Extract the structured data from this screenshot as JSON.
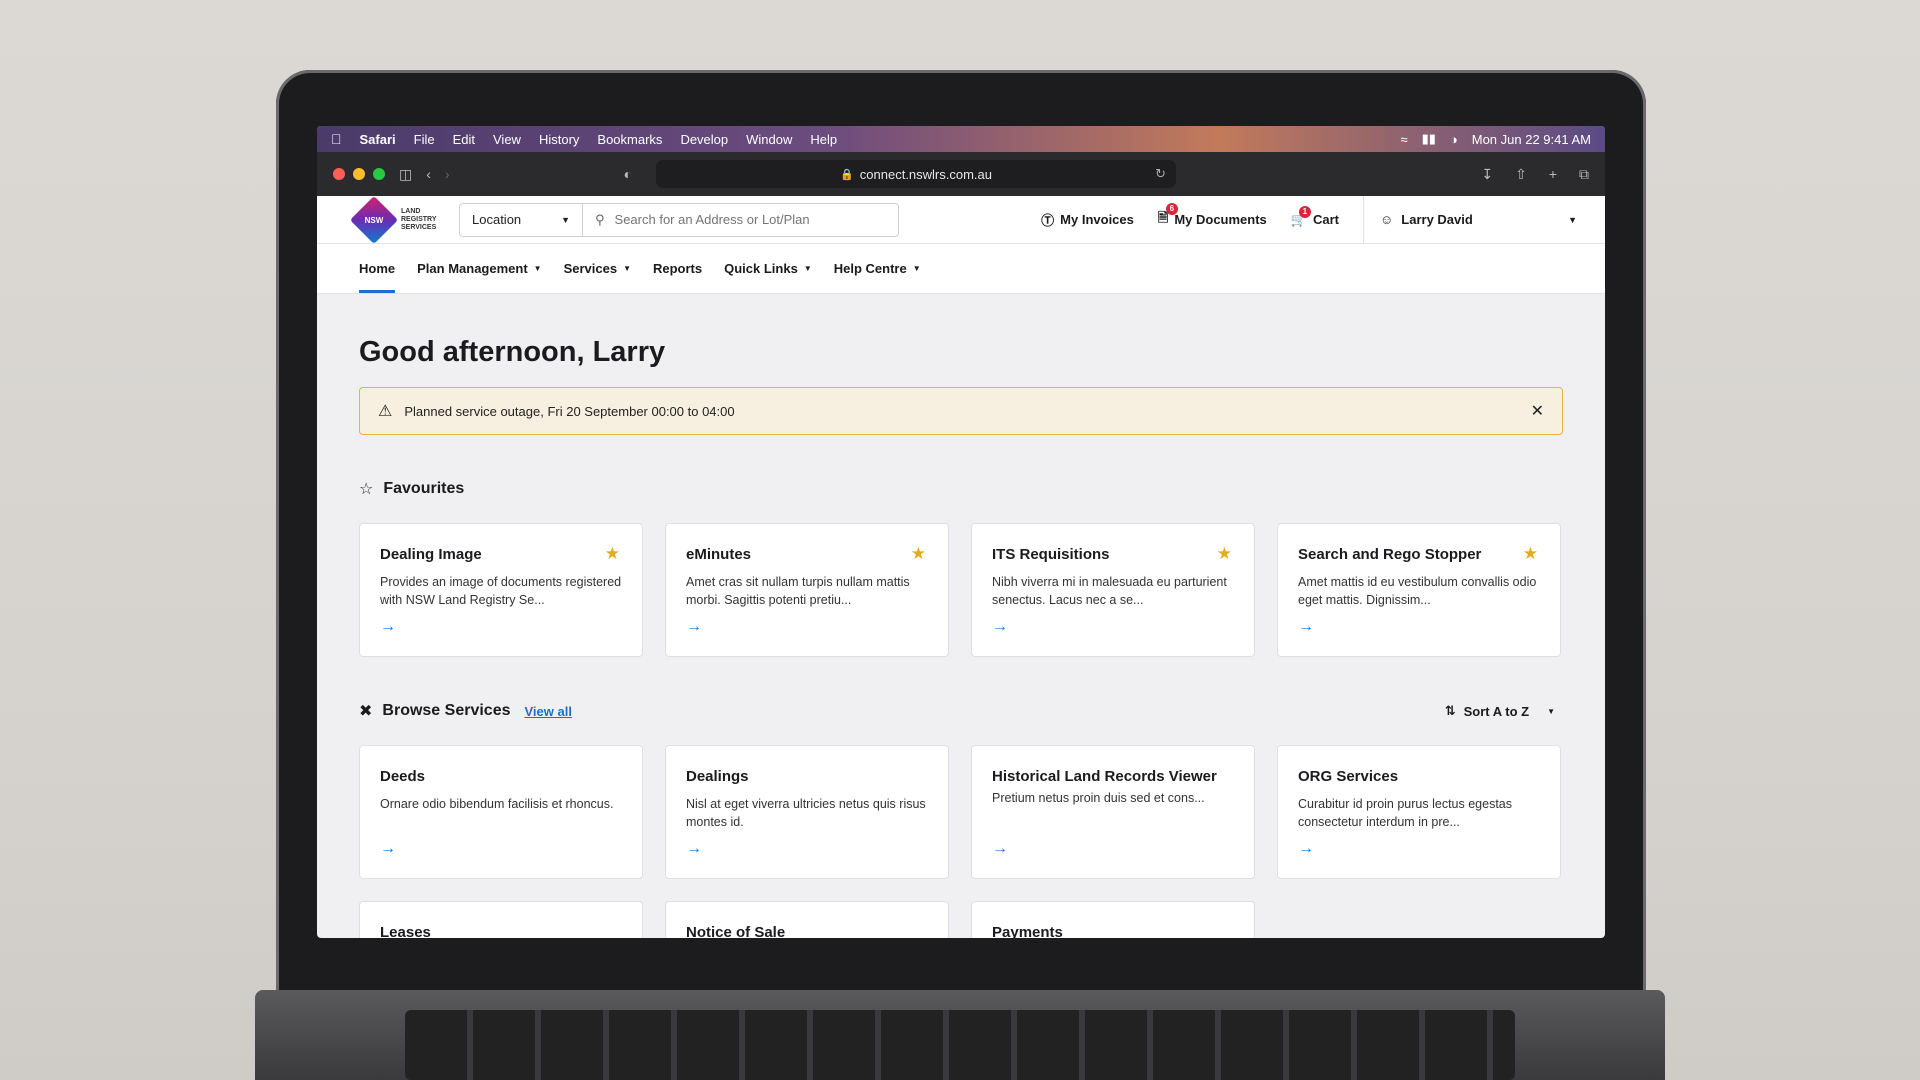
{
  "menubar": {
    "app": "Safari",
    "items": [
      "File",
      "Edit",
      "View",
      "History",
      "Bookmarks",
      "Develop",
      "Window",
      "Help"
    ],
    "clock": "Mon Jun 22  9:41 AM"
  },
  "browser": {
    "url": "connect.nswlrs.com.au"
  },
  "logo": {
    "mark": "NSW",
    "line1": "LAND",
    "line2": "REGISTRY",
    "line3": "SERVICES"
  },
  "header": {
    "location_label": "Location",
    "search_placeholder": "Search for an Address or Lot/Plan",
    "invoices": "My Invoices",
    "documents": "My Documents",
    "documents_badge": "6",
    "cart": "Cart",
    "cart_badge": "1",
    "user": "Larry David"
  },
  "nav": {
    "items": [
      "Home",
      "Plan Management",
      "Services",
      "Reports",
      "Quick Links",
      "Help Centre"
    ]
  },
  "greeting": "Good afternoon, Larry",
  "alert": {
    "text": "Planned service outage, Fri 20 September 00:00 to 04:00"
  },
  "favourites": {
    "title": "Favourites",
    "cards": [
      {
        "title": "Dealing Image",
        "desc": "Provides an image of documents registered with NSW Land Registry Se..."
      },
      {
        "title": "eMinutes",
        "desc": "Amet cras sit nullam turpis nullam mattis morbi. Sagittis potenti pretiu..."
      },
      {
        "title": "ITS Requisitions",
        "desc": "Nibh viverra mi in malesuada eu parturient senectus. Lacus nec a se..."
      },
      {
        "title": "Search and Rego Stopper",
        "desc": "Amet mattis id eu vestibulum convallis odio eget mattis. Dignissim..."
      }
    ]
  },
  "browse": {
    "title": "Browse Services",
    "view_all": "View all",
    "sort": "Sort A to Z",
    "cards": [
      {
        "title": "Deeds",
        "desc": "Ornare odio bibendum facilisis et rhoncus."
      },
      {
        "title": "Dealings",
        "desc": "Nisl at eget viverra ultricies netus quis risus montes id."
      },
      {
        "title": "Historical Land Records Viewer",
        "desc": "Pretium netus proin duis sed et cons..."
      },
      {
        "title": "ORG Services",
        "desc": "Curabitur id proin purus lectus egestas consectetur interdum in pre..."
      }
    ],
    "more": [
      "Leases",
      "Notice of Sale",
      "Payments"
    ]
  },
  "colors": {
    "accent": "#1a6fd1",
    "star": "#e3ad1c",
    "alert_border": "#e0b545",
    "alert_bg": "#f7f0e1"
  }
}
